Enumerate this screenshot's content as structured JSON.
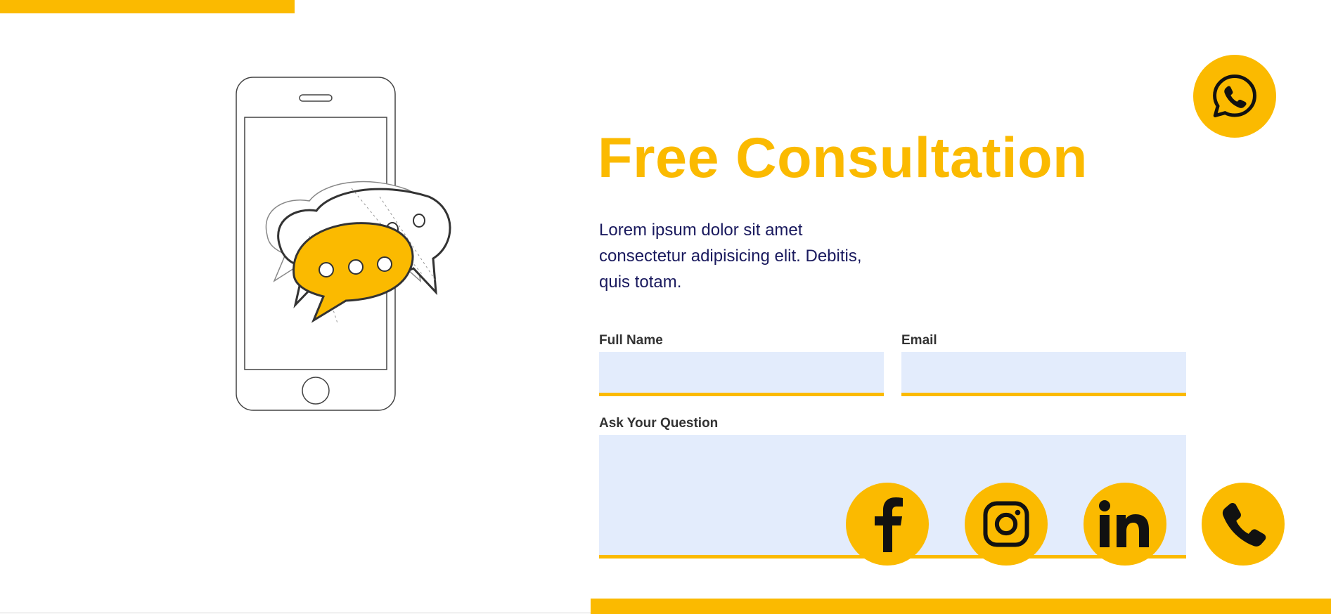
{
  "hero": {
    "title": "Free Consultation",
    "description": "Lorem ipsum dolor sit amet consectetur adipisicing elit. Debitis, quis totam."
  },
  "form": {
    "full_name": {
      "label": "Full Name",
      "value": "",
      "placeholder": ""
    },
    "email": {
      "label": "Email",
      "value": "",
      "placeholder": ""
    },
    "question": {
      "label": "Ask Your Question",
      "value": "",
      "placeholder": ""
    }
  },
  "social": [
    {
      "icon": "whatsapp-icon"
    },
    {
      "icon": "facebook-icon"
    },
    {
      "icon": "instagram-icon"
    },
    {
      "icon": "linkedin-icon"
    },
    {
      "icon": "phone-icon"
    }
  ],
  "colors": {
    "accent": "#FBBA00",
    "field_bg": "#E3ECFC",
    "text_dark": "#1a1a5e",
    "label": "#333333",
    "icon": "#111111"
  }
}
